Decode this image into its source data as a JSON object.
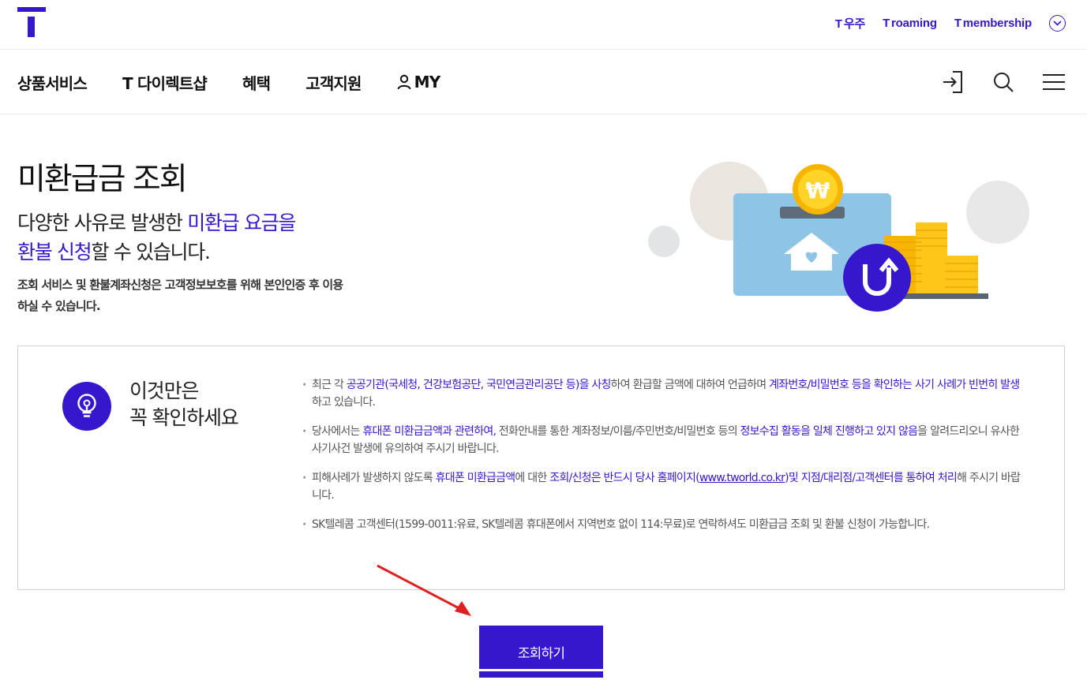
{
  "header": {
    "logo_icon": "t-logo-icon",
    "links": [
      {
        "prefix": "T",
        "label": "우주"
      },
      {
        "prefix": "T",
        "label": "roaming"
      },
      {
        "prefix": "T",
        "label": "membership"
      }
    ],
    "more_icon": "chevron-down-circle-icon",
    "accent_color": "#3617ce"
  },
  "gnb": {
    "menu": [
      "상품서비스",
      "T 다이렉트샵",
      "혜택",
      "고객지원",
      "MY"
    ],
    "my_icon": "person-icon",
    "icons": [
      "login-icon",
      "search-icon",
      "hamburger-menu-icon"
    ]
  },
  "hero": {
    "title": "미환급금 조회",
    "sub_part1": "다양한 사유로 발생한 ",
    "sub_hl1": "미환급 요금을",
    "sub_hl2": "환불 신청",
    "sub_part2": "할 수 있습니다.",
    "note": "조회 서비스 및 환불계좌신청은 고객정보보호를 위해 본인인증 후 이용하실 수 있습니다.",
    "illustration": "refund-wallet-coins-illustration",
    "coin_symbol": "₩"
  },
  "notice": {
    "icon": "lightbulb-icon",
    "title_line1": "이것만은",
    "title_line2": "꼭 확인하세요",
    "items": [
      {
        "parts": [
          {
            "t": "최근 각 "
          },
          {
            "t": "공공기관(국세청, 건강보험공단, 국민연금관리공단 등)을 사칭",
            "hl": true
          },
          {
            "t": "하여 환급할 금액에 대하여 언급하며 "
          },
          {
            "t": "계좌번호/비밀번호 등을 확인하는 사기 사례가 빈번히 발생",
            "hl": true
          },
          {
            "t": "하고 있습니다."
          }
        ]
      },
      {
        "parts": [
          {
            "t": "당사에서는 "
          },
          {
            "t": "휴대폰 미환급금액과 관련하여,",
            "hl": true
          },
          {
            "t": " 전화안내를 통한 계좌정보/이름/주민번호/비밀번호 등의 "
          },
          {
            "t": "정보수집 활동을 일체 진행하고 있지 않음",
            "hl": true
          },
          {
            "t": "을 알려드리오니 유사한 사기사건 발생에 유의하여 주시기 바랍니다."
          }
        ]
      },
      {
        "parts": [
          {
            "t": "피해사례가 발생하지 않도록 "
          },
          {
            "t": "휴대폰 미환급금액",
            "hl": true
          },
          {
            "t": "에 대한 "
          },
          {
            "t": "조회/신청은 반드시 당사 홈페이지(",
            "hl": true
          },
          {
            "t": "www.tworld.co.kr",
            "hl": true,
            "ul": true
          },
          {
            "t": ")및 지점/대리점/고객센터를 통하여 처리",
            "hl": true
          },
          {
            "t": "해 주시기 바랍니다."
          }
        ]
      },
      {
        "parts": [
          {
            "t": "SK텔레콤 고객센터(1599-0011:유료, SK텔레콤 휴대폰에서 지역번호 없이 114:무료)로 연락하셔도 미환급금 조회 및 환불 신청이 가능합니다."
          }
        ]
      }
    ]
  },
  "annotation": {
    "arrow_color": "#e02020"
  },
  "cta": {
    "label": "조회하기"
  }
}
